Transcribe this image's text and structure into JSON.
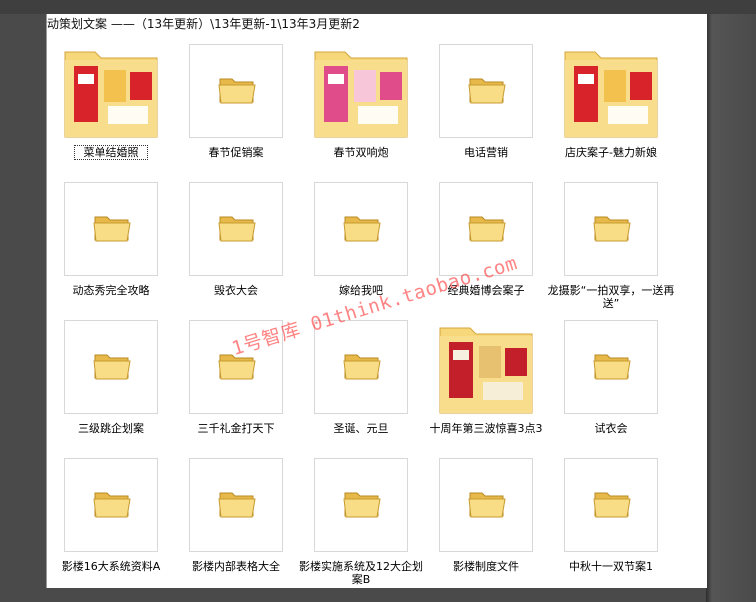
{
  "window": {
    "address_path": "动策划文案 ——（13年更新）\\13年更新-1\\13年3月更新2"
  },
  "items": [
    {
      "label": "菜单结婚照",
      "thumb": "collage",
      "selected": true
    },
    {
      "label": "春节促销案",
      "thumb": "folder"
    },
    {
      "label": "春节双响炮",
      "thumb": "collage"
    },
    {
      "label": "电话营销",
      "thumb": "folder"
    },
    {
      "label": "店庆案子-魅力新娘",
      "thumb": "collage"
    },
    {
      "label": "动态秀完全攻略",
      "thumb": "folder"
    },
    {
      "label": "毁衣大会",
      "thumb": "folder"
    },
    {
      "label": "嫁给我吧",
      "thumb": "folder"
    },
    {
      "label": "经典婚博会案子",
      "thumb": "folder"
    },
    {
      "label": "龙摄影“一拍双享，一送再送”",
      "thumb": "folder"
    },
    {
      "label": "三级跳企划案",
      "thumb": "folder"
    },
    {
      "label": "三千礼金打天下",
      "thumb": "folder"
    },
    {
      "label": "圣诞、元旦",
      "thumb": "folder"
    },
    {
      "label": "十周年第三波惊喜3点3",
      "thumb": "collage"
    },
    {
      "label": "试衣会",
      "thumb": "folder"
    },
    {
      "label": "影楼16大系统资料A",
      "thumb": "folder"
    },
    {
      "label": "影楼内部表格大全",
      "thumb": "folder"
    },
    {
      "label": "影楼实施系统及12大企划案B",
      "thumb": "folder"
    },
    {
      "label": "影楼制度文件",
      "thumb": "folder"
    },
    {
      "label": "中秋十一双节案1",
      "thumb": "folder"
    }
  ],
  "watermark": "1号智库 01think.taobao.com",
  "colors": {
    "folder_yellow": "#f6d77a",
    "folder_edge": "#d4a63c",
    "watermark_red": "#ff1e1e"
  }
}
